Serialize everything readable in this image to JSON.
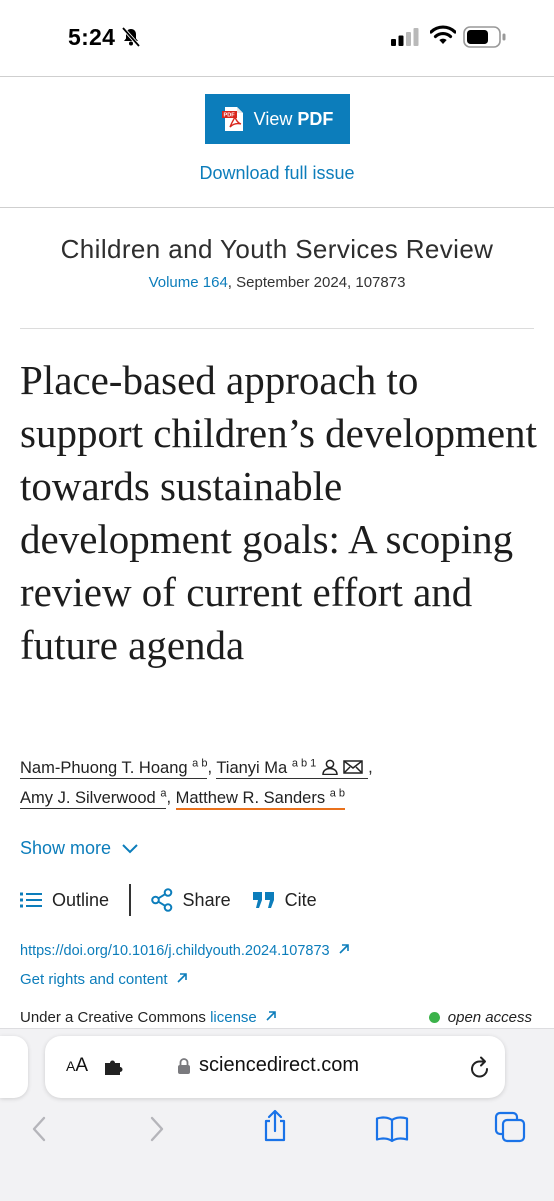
{
  "status_bar": {
    "time": "5:24"
  },
  "actions": {
    "view_pdf_prefix": "View",
    "view_pdf_bold": "PDF",
    "download": "Download full issue"
  },
  "journal": {
    "title": "Children and Youth Services Review",
    "volume_link": "Volume 164",
    "issue_info": ", September 2024, 107873"
  },
  "article": {
    "title": "Place-based approach to support children’s development towards sustainable development goals: A scoping review of current effort and future agenda",
    "authors": [
      {
        "name": "Nam-Phuong T. Hoang",
        "sup": "a b"
      },
      {
        "name": "Tianyi Ma",
        "sup": "a b 1"
      },
      {
        "name": "Amy J. Silverwood",
        "sup": "a"
      },
      {
        "name": "Matthew R. Sanders",
        "sup": "a b"
      }
    ],
    "show_more": "Show more",
    "toolbar": {
      "outline": "Outline",
      "share": "Share",
      "cite": "Cite"
    },
    "doi": "https://doi.org/10.1016/j.childyouth.2024.107873",
    "rights": "Get rights and content",
    "license_prefix": "Under a Creative Commons ",
    "license_link": "license",
    "open_access": "open access"
  },
  "browser": {
    "reader_large": "A",
    "reader_small": "A",
    "domain": "sciencedirect.com"
  },
  "colors": {
    "link": "#0c7dbb",
    "accent_underline": "#e9711c",
    "open_access_dot": "#3bb24a"
  },
  "icons": [
    "bell-slash-icon",
    "signal-icon",
    "wifi-icon",
    "battery-icon",
    "pdf-icon",
    "external-arrow-icon",
    "person-icon",
    "mail-icon",
    "chevron-down-icon",
    "list-icon",
    "share-nodes-icon",
    "quote-icon",
    "extension-icon",
    "lock-icon",
    "reload-icon",
    "back-icon",
    "forward-icon",
    "share-icon",
    "book-icon",
    "tabs-icon"
  ]
}
